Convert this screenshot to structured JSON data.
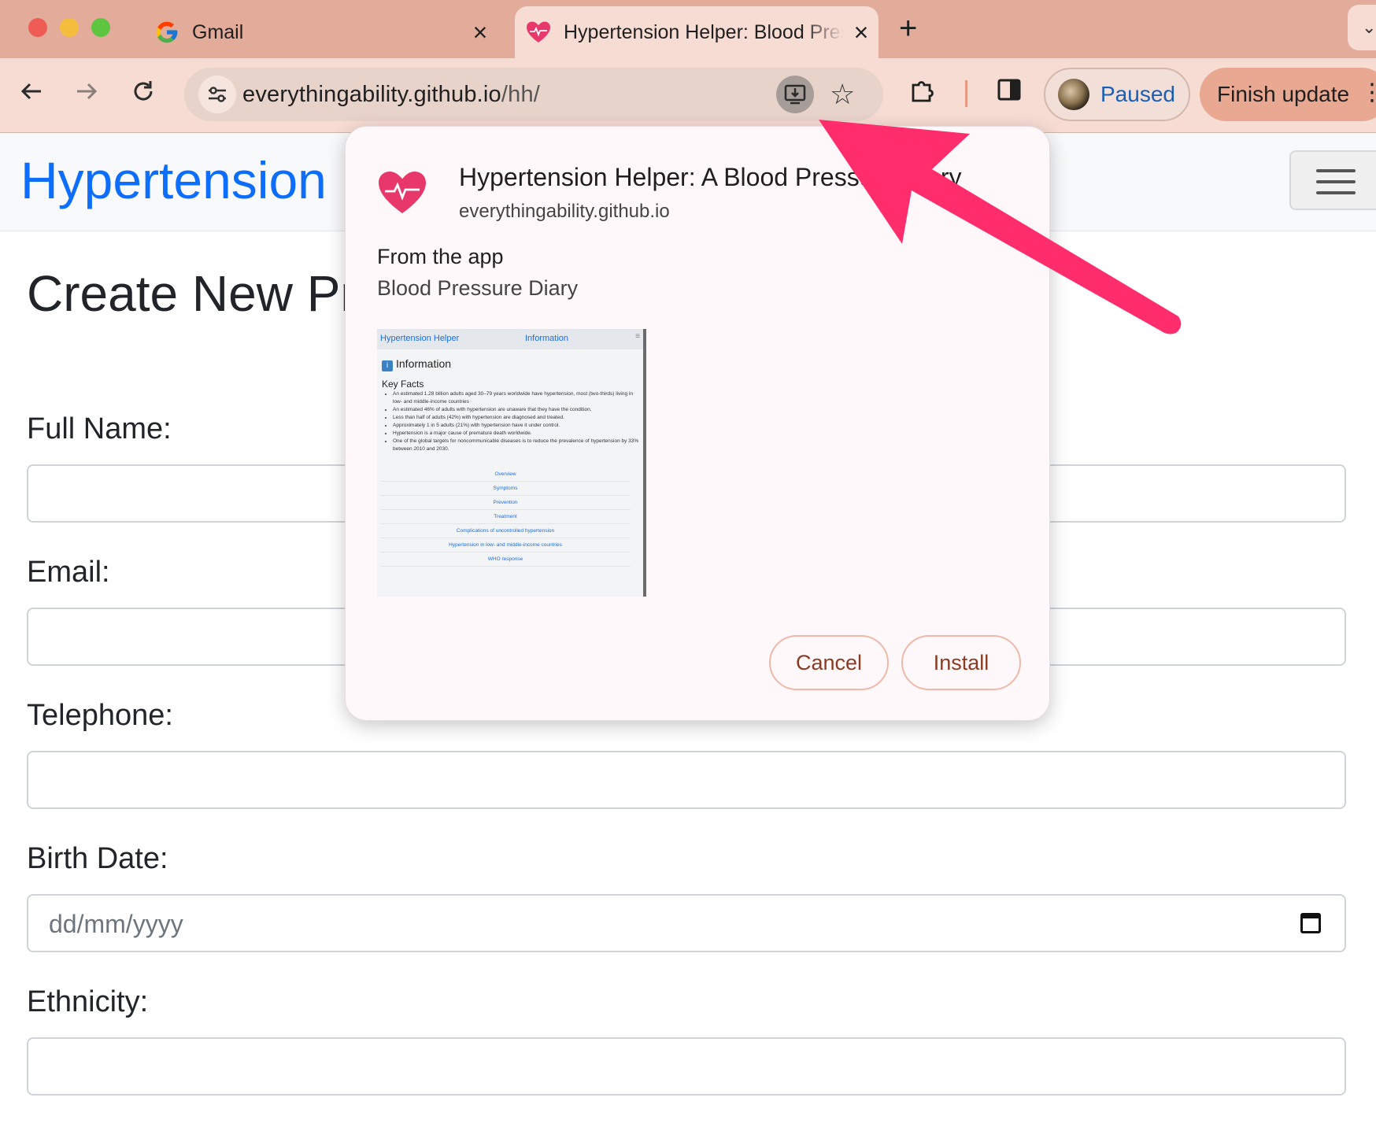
{
  "browser": {
    "tabs": [
      {
        "title": "Gmail",
        "active": false,
        "icon": "google-g-icon"
      },
      {
        "title": "Hypertension Helper: Blood Pressure Diary",
        "active": true,
        "icon": "heart-pulse-icon"
      }
    ],
    "url": {
      "host": "everythingability.github.io",
      "path": "/hh/"
    },
    "profile": {
      "status": "Paused"
    },
    "update_label": "Finish update",
    "colors": {
      "tabstrip": "#e3ab9a",
      "toolbar": "#f6dcd3",
      "profile_text": "#1a5fb4"
    }
  },
  "page": {
    "brand": "Hypertension Helper",
    "title": "Create New Profile",
    "fields": [
      {
        "label": "Full Name:",
        "value": ""
      },
      {
        "label": "Email:",
        "value": ""
      },
      {
        "label": "Telephone:",
        "value": ""
      },
      {
        "label": "Birth Date:",
        "placeholder": "dd/mm/yyyy"
      },
      {
        "label": "Ethnicity:",
        "value": ""
      }
    ],
    "colors": {
      "brand": "#0d6efd"
    }
  },
  "dialog": {
    "app_name": "Hypertension Helper: A Blood Pressure Diary",
    "origin": "everythingability.github.io",
    "from_label": "From the app",
    "from_app": "Blood Pressure Diary",
    "screenshot": {
      "brand": "Hypertension Helper",
      "nav_link": "Information",
      "heading": "Information",
      "subheading": "Key Facts",
      "facts": [
        "An estimated 1.28 billion adults aged 30–79 years worldwide have hypertension, most (two-thirds) living in low- and middle-income countries",
        "An estimated 46% of adults with hypertension are unaware that they have the condition.",
        "Less than half of adults (42%) with hypertension are diagnosed and treated.",
        "Approximately 1 in 5 adults (21%) with hypertension have it under control.",
        "Hypertension is a major cause of premature death worldwide.",
        "One of the global targets for noncommunicable diseases is to reduce the prevalence of hypertension by 33% between 2010 and 2030."
      ],
      "links": [
        "Overview",
        "Symptoms",
        "Prevention",
        "Treatment",
        "Complications of uncontrolled hypertension",
        "Hypertension in low- and middle-income countries",
        "WHO response"
      ]
    },
    "cancel_label": "Cancel",
    "install_label": "Install",
    "colors": {
      "button_text": "#8b3a22",
      "button_border": "#efb8a8",
      "heart": "#e8386b"
    }
  },
  "annotation": {
    "arrow_color": "#ff2d6b",
    "icon": "pointer-arrow"
  }
}
